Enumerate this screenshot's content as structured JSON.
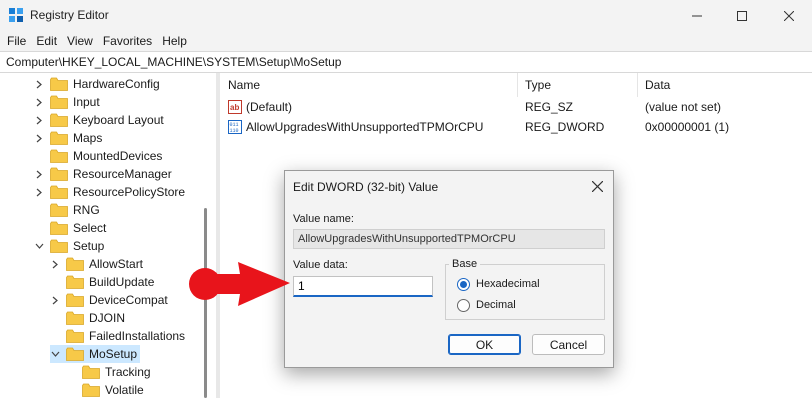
{
  "window": {
    "title": "Registry Editor",
    "icon": "registry-editor-icon",
    "controls": [
      "minimize-icon",
      "maximize-icon",
      "close-icon"
    ]
  },
  "menu": [
    "File",
    "Edit",
    "View",
    "Favorites",
    "Help"
  ],
  "address": "Computer\\HKEY_LOCAL_MACHINE\\SYSTEM\\Setup\\MoSetup",
  "tree": [
    {
      "label": "HardwareConfig",
      "depth": 0,
      "expander": "collapsed"
    },
    {
      "label": "Input",
      "depth": 0,
      "expander": "collapsed"
    },
    {
      "label": "Keyboard Layout",
      "depth": 0,
      "expander": "collapsed"
    },
    {
      "label": "Maps",
      "depth": 0,
      "expander": "collapsed"
    },
    {
      "label": "MountedDevices",
      "depth": 0,
      "expander": "none"
    },
    {
      "label": "ResourceManager",
      "depth": 0,
      "expander": "collapsed"
    },
    {
      "label": "ResourcePolicyStore",
      "depth": 0,
      "expander": "collapsed"
    },
    {
      "label": "RNG",
      "depth": 0,
      "expander": "none"
    },
    {
      "label": "Select",
      "depth": 0,
      "expander": "none"
    },
    {
      "label": "Setup",
      "depth": 0,
      "expander": "expanded"
    },
    {
      "label": "AllowStart",
      "depth": 1,
      "expander": "collapsed"
    },
    {
      "label": "BuildUpdate",
      "depth": 1,
      "expander": "none"
    },
    {
      "label": "DeviceCompat",
      "depth": 1,
      "expander": "collapsed"
    },
    {
      "label": "DJOIN",
      "depth": 1,
      "expander": "none"
    },
    {
      "label": "FailedInstallations",
      "depth": 1,
      "expander": "none"
    },
    {
      "label": "MoSetup",
      "depth": 1,
      "expander": "expanded",
      "selected": true
    },
    {
      "label": "Tracking",
      "depth": 2,
      "expander": "none"
    },
    {
      "label": "Volatile",
      "depth": 2,
      "expander": "none"
    }
  ],
  "list": {
    "columns": [
      "Name",
      "Type",
      "Data"
    ],
    "rows": [
      {
        "icon": "string-value-icon",
        "name": "(Default)",
        "type": "REG_SZ",
        "data": "(value not set)"
      },
      {
        "icon": "dword-value-icon",
        "name": "AllowUpgradesWithUnsupportedTPMOrCPU",
        "type": "REG_DWORD",
        "data": "0x00000001 (1)"
      }
    ]
  },
  "dialog": {
    "title": "Edit DWORD (32-bit) Value",
    "value_name_label": "Value name:",
    "value_name": "AllowUpgradesWithUnsupportedTPMOrCPU",
    "value_data_label": "Value data:",
    "value_data": "1",
    "base_label": "Base",
    "base_options": [
      {
        "label": "Hexadecimal",
        "checked": true
      },
      {
        "label": "Decimal",
        "checked": false
      }
    ],
    "ok_label": "OK",
    "cancel_label": "Cancel"
  },
  "colors": {
    "folder": "#f7c948",
    "selection": "#cce8ff",
    "accent": "#1a66c4",
    "arrow": "#e8141b"
  }
}
